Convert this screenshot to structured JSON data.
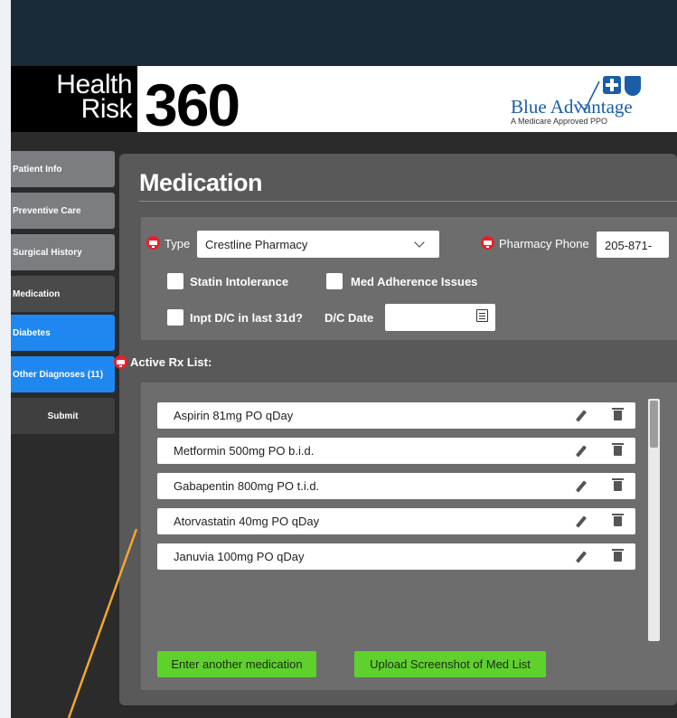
{
  "brand": {
    "health": "Health",
    "risk": "Risk",
    "number": "360",
    "partner_title": "Blue Advantage",
    "partner_sub": "A Medicare Approved PPO"
  },
  "sidebar": {
    "items": [
      {
        "label": "Patient Info"
      },
      {
        "label": "Preventive Care"
      },
      {
        "label": "Surgical History"
      },
      {
        "label": "Medication"
      },
      {
        "label": "Diabetes"
      },
      {
        "label": "Other Diagnoses (11)"
      },
      {
        "label": "Submit"
      }
    ]
  },
  "page": {
    "title": "Medication"
  },
  "form": {
    "type_label": "Type",
    "type_value": "Crestline Pharmacy",
    "pharmacy_phone_label": "Pharmacy Phone",
    "pharmacy_phone_value": "205-871-",
    "statin_label": "Statin Intolerance",
    "adherence_label": "Med Adherence Issues",
    "inpt_label": "Inpt D/C in last 31d?",
    "dc_date_label": "D/C Date"
  },
  "rx_list": {
    "heading": "Active Rx List:",
    "items": [
      "Aspirin 81mg PO qDay",
      "Metformin 500mg PO b.i.d.",
      "Gabapentin 800mg PO t.i.d.",
      "Atorvastatin 40mg PO qDay",
      "Januvia 100mg PO qDay"
    ]
  },
  "buttons": {
    "enter_another": "Enter another medication",
    "upload_screenshot": "Upload Screenshot of Med List"
  },
  "colors": {
    "accent_green": "#5ed12d",
    "nav_blue": "#1e88f0",
    "robot_red": "#e8202a",
    "annotation": "#f4a532"
  }
}
